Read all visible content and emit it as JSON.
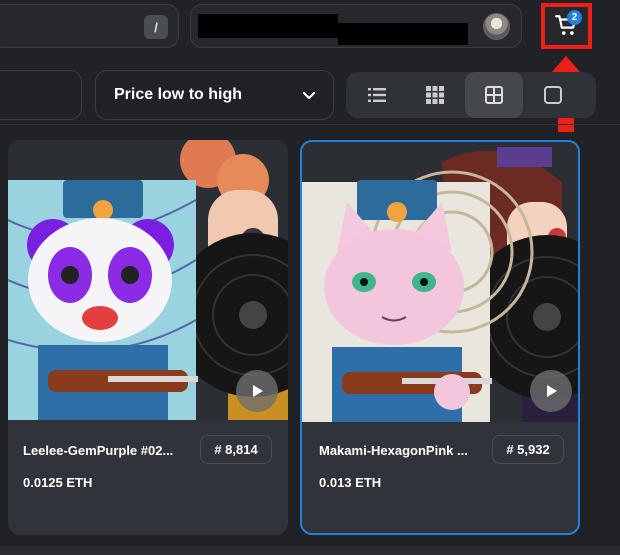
{
  "header": {
    "search_shortcut": "/",
    "cart_count": "2"
  },
  "toolbar": {
    "sort_label": "Price low to high"
  },
  "cards": [
    {
      "name": "Leelee-GemPurple #02...",
      "rank": "# 8,814",
      "price": "0.0125 ETH"
    },
    {
      "name": "Makami-HexagonPink ...",
      "rank": "# 5,932",
      "price": "0.013 ETH"
    }
  ],
  "colors": {
    "accent": "#2081e2",
    "highlight": "#ee1f18"
  }
}
